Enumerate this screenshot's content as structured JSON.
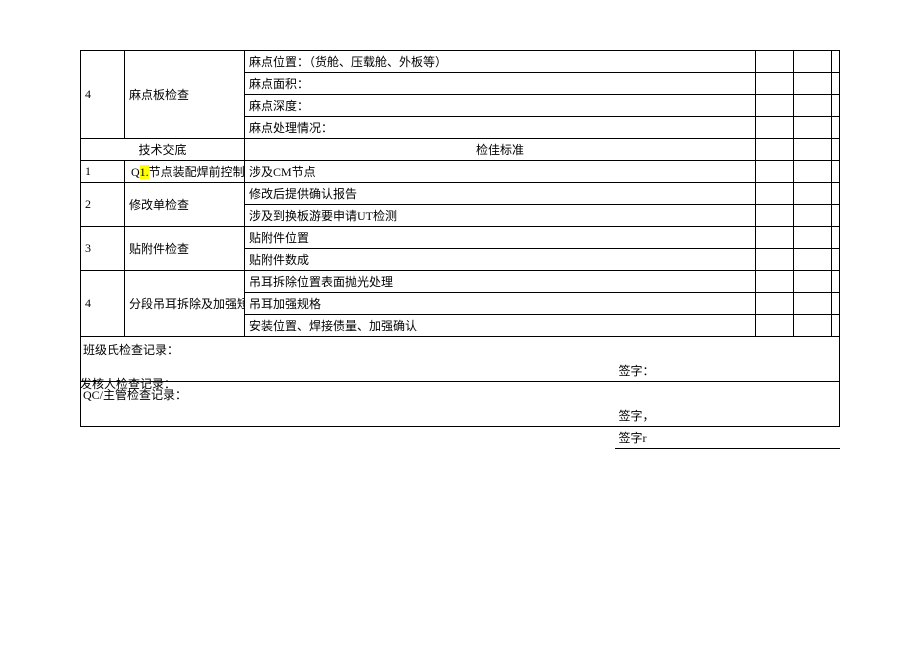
{
  "section1": {
    "r4": {
      "num": "4",
      "item": "麻点板检查",
      "lines": [
        "麻点位置：（货舱、压载舱、外板等）",
        "麻点面积：",
        "麻点深度：",
        "麻点处理情况："
      ]
    }
  },
  "header2": {
    "tech": "技术交底",
    "standard": "检佳标准"
  },
  "section2": {
    "r1": {
      "num": "1",
      "prefix": "Q",
      "hl": "1.",
      "suffix": "节点装配焊前控制",
      "lines": [
        "涉及CM节点"
      ]
    },
    "r2": {
      "num": "2",
      "item": "修改单检查",
      "lines": [
        "修改后提供确认报告",
        "涉及到换板游要申请UT检测"
      ]
    },
    "r3": {
      "num": "3",
      "item": "贴附件检查",
      "lines": [
        "贴附件位置",
        "贴附件数成"
      ]
    },
    "r4": {
      "num": "4",
      "item": "分段吊耳拆除及加强短接",
      "lines": [
        "吊耳拆除位置表面抛光处理",
        "吊耳加强规格",
        "安装位置、焊接债量、加强确认"
      ]
    }
  },
  "records": {
    "class_record": "班级氏检查记录：",
    "qc_record": "QC/主管检查记录：",
    "issuer_record": "发核人检查记录：",
    "sign1": "签字：",
    "sign2": "签字，",
    "sign3": "签字r"
  }
}
